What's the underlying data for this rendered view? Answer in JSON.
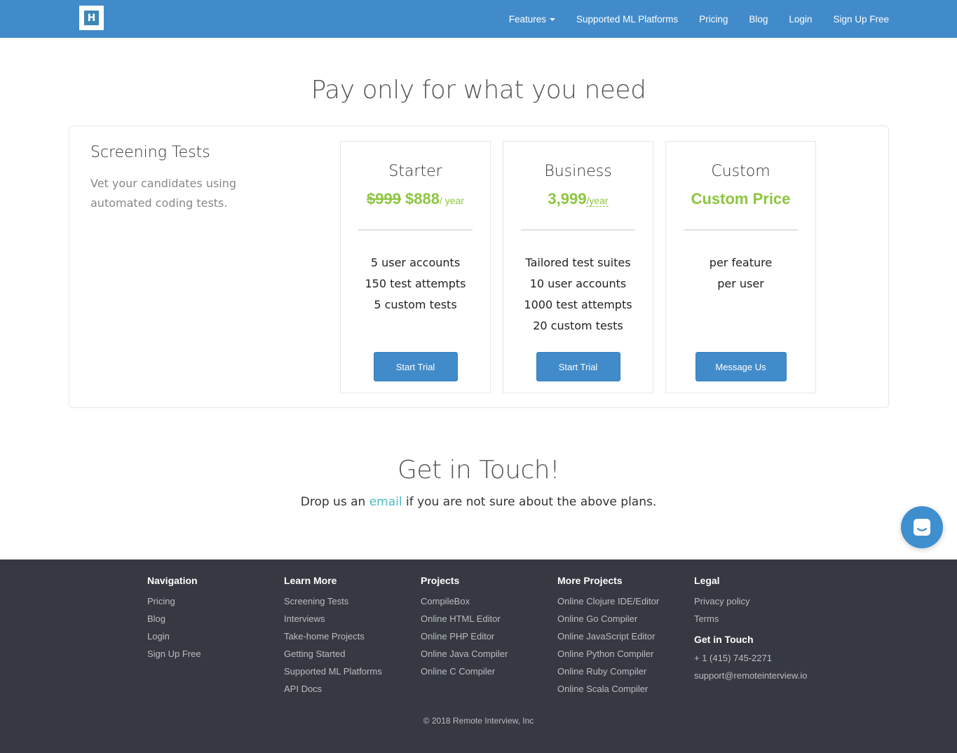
{
  "nav": {
    "logo_letter": "H",
    "items": [
      {
        "label": "Features",
        "dropdown": true
      },
      {
        "label": "Supported ML Platforms"
      },
      {
        "label": "Pricing"
      },
      {
        "label": "Blog"
      },
      {
        "label": "Login"
      },
      {
        "label": "Sign Up Free"
      }
    ]
  },
  "headline": "Pay only for what you need",
  "section": {
    "title": "Screening Tests",
    "description": "Vet your candidates using automated coding tests."
  },
  "plans": [
    {
      "name": "Starter",
      "old_price": "$999",
      "price": "$888",
      "period": "/ year",
      "features": [
        "5 user accounts",
        "150 test attempts",
        "5 custom tests"
      ],
      "button": "Start Trial"
    },
    {
      "name": "Business",
      "price": "3,999",
      "period": "/year",
      "features": [
        "Tailored test suites",
        "10 user accounts",
        "1000 test attempts",
        "20 custom tests"
      ],
      "button": "Start Trial"
    },
    {
      "name": "Custom",
      "price": "Custom Price",
      "features": [
        "per feature",
        "per user"
      ],
      "button": "Message Us"
    }
  ],
  "touch": {
    "title": "Get in Touch!",
    "text_before": "Drop us an ",
    "link": "email",
    "text_after": " if you are not sure about the above plans."
  },
  "footer": {
    "navigation": {
      "title": "Navigation",
      "links": [
        "Pricing",
        "Blog",
        "Login",
        "Sign Up Free"
      ]
    },
    "learn_more": {
      "title": "Learn More",
      "links": [
        "Screening Tests",
        "Interviews",
        "Take-home Projects",
        "Getting Started",
        "Supported ML Platforms",
        "API Docs"
      ]
    },
    "projects": {
      "title": "Projects",
      "links": [
        "CompileBox",
        "Online HTML Editor",
        "Online PHP Editor",
        "Online Java Compiler",
        "Online C Compiler"
      ]
    },
    "more_projects": {
      "title": "More Projects",
      "links": [
        "Online Clojure IDE/Editor",
        "Online Go Compiler",
        "Online JavaScript Editor",
        "Online Python Compiler",
        "Online Ruby Compiler",
        "Online Scala Compiler"
      ]
    },
    "legal": {
      "title": "Legal",
      "links": [
        "Privacy policy",
        "Terms"
      ]
    },
    "contact": {
      "title": "Get in Touch",
      "phone": "+ 1 (415) 745-2271",
      "email": "support@remoteinterview.io"
    },
    "copyright": "© 2018 Remote Interview, Inc"
  },
  "colors": {
    "navbar": "#428bca",
    "accent_green": "#8dc63f",
    "link_teal": "#4cb8c4",
    "footer_bg": "#363942"
  }
}
